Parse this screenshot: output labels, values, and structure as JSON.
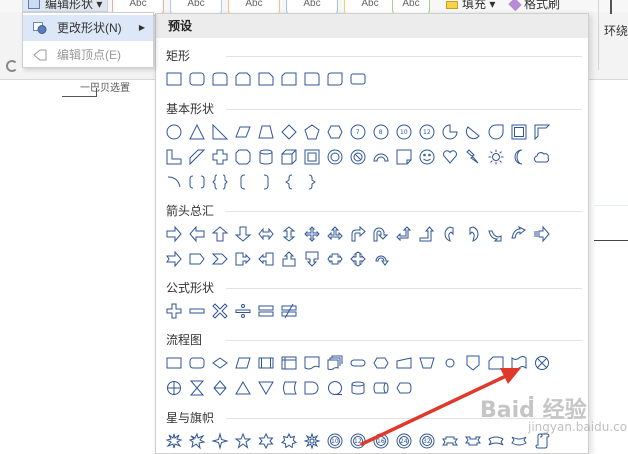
{
  "ribbon": {
    "edit_shape_label": "编辑形状 ▾",
    "style_thumbs": [
      "Abc",
      "Abc",
      "Abc",
      "Abc",
      "Abc",
      "Abc"
    ],
    "fill_label": "填充 ▾",
    "format_brush_label": "格式刷",
    "env_label": "环绕",
    "doc_fragment": "一巴贝选置"
  },
  "submenu": {
    "change_shape": "更改形状(N)",
    "change_shape_arrow": "▶",
    "edit_points": "编辑顶点(E)"
  },
  "panel": {
    "header": "预设",
    "sections": [
      {
        "title": "矩形"
      },
      {
        "title": "基本形状"
      },
      {
        "title": "箭头总汇"
      },
      {
        "title": "公式形状"
      },
      {
        "title": "流程图"
      },
      {
        "title": "星与旗帜"
      }
    ],
    "basic_labels": [
      "7",
      "8",
      "10",
      "12"
    ]
  },
  "watermark": {
    "brand": "Baiḋ 经验",
    "sub": "jingyan.baidu.com"
  },
  "colors": {
    "shape_stroke": "#2f5597",
    "arrow": "#e0392b",
    "highlight": "#dce8f8"
  }
}
